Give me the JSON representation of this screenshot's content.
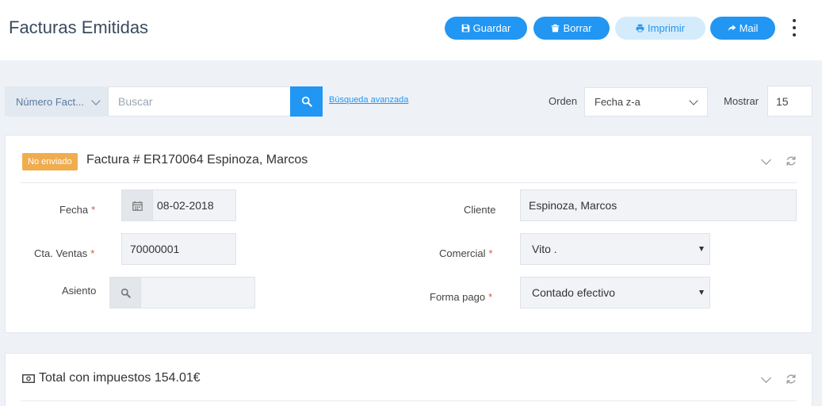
{
  "header": {
    "title": "Facturas Emitidas",
    "buttons": {
      "guardar": "Guardar",
      "borrar": "Borrar",
      "imprimir": "Imprimir",
      "mail": "Mail"
    }
  },
  "filters": {
    "field_select": "Número Fact...",
    "search_placeholder": "Buscar",
    "search_value": "",
    "advanced_link": "Búsqueda avanzada",
    "orden_label": "Orden",
    "orden_value": "Fecha z-a",
    "mostrar_label": "Mostrar",
    "mostrar_value": "15"
  },
  "invoice": {
    "status_badge": "No enviado",
    "title": "Factura # ER170064 Espinoza, Marcos",
    "fields": {
      "fecha_label": "Fecha",
      "fecha_value": "08-02-2018",
      "cta_label": "Cta. Ventas",
      "cta_value": "70000001",
      "asiento_label": "Asiento",
      "asiento_value": "",
      "cliente_label": "Cliente",
      "cliente_value": "Espinoza, Marcos",
      "comercial_label": "Comercial",
      "comercial_value": "Vito .",
      "forma_pago_label": "Forma pago",
      "forma_pago_value": "Contado efectivo"
    },
    "required_mark": "*"
  },
  "totals": {
    "title": "Total con impuestos 154.01€"
  },
  "colors": {
    "primary": "#2196f3",
    "badge": "#f0ad4e",
    "required": "#d9534f"
  },
  "icons": {
    "save": "floppy-icon",
    "delete": "trash-icon",
    "print": "printer-icon",
    "mail": "share-arrow-icon",
    "search": "search-icon",
    "calendar": "calendar-icon",
    "money": "money-icon",
    "refresh": "refresh-icon"
  }
}
